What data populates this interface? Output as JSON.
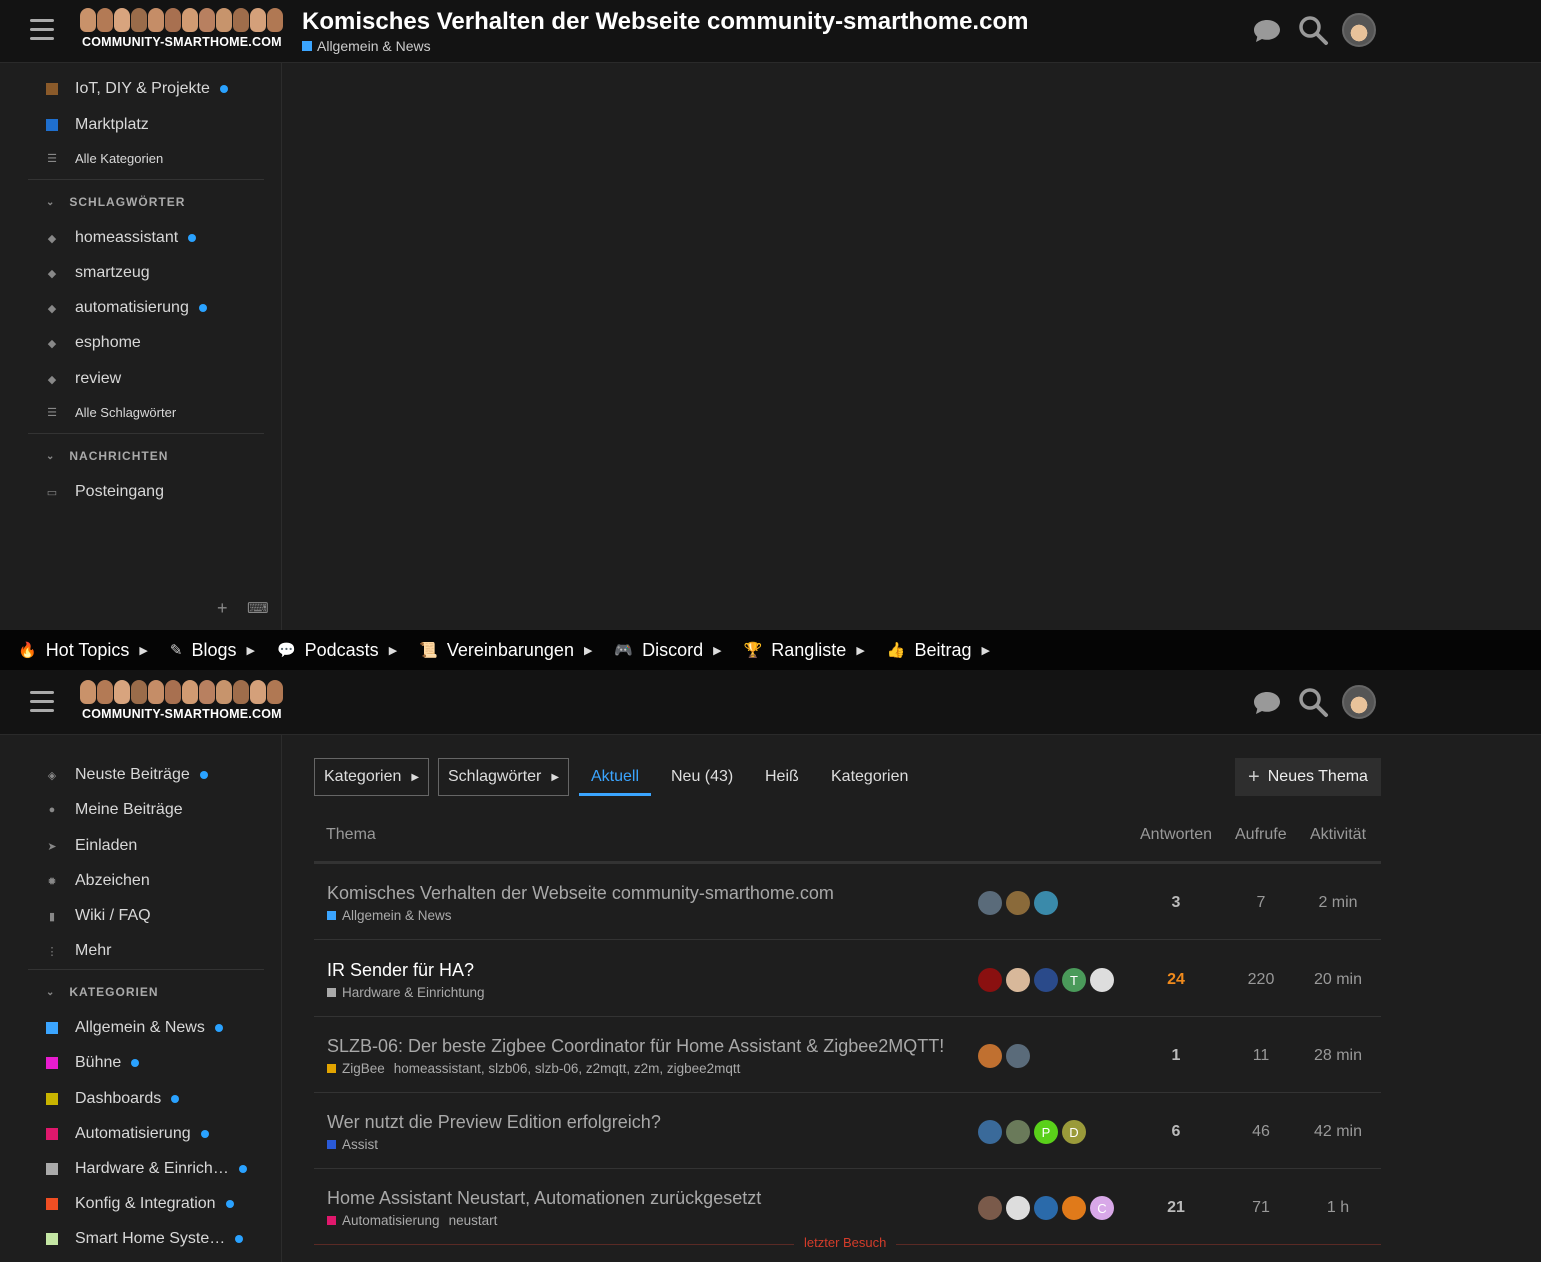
{
  "top_header": {
    "logo_text": "COMMUNITY-SMARTHOME.COM",
    "topic_title": "Komisches Verhalten der Webseite community-smarthome.com",
    "topic_category": "Allgemein & News",
    "category_color": "#3ba5ff"
  },
  "top_sidebar": {
    "categories": [
      {
        "label": "IoT, DIY & Projekte",
        "color": "#8a5a2a",
        "unread": true
      },
      {
        "label": "Marktplatz",
        "color": "#1f6fce",
        "unread": false
      }
    ],
    "all_categories": "Alle Kategorien",
    "tags_heading": "SCHLAGWÖRTER",
    "tags": [
      {
        "label": "homeassistant",
        "unread": true
      },
      {
        "label": "smartzeug",
        "unread": false
      },
      {
        "label": "automatisierung",
        "unread": true
      },
      {
        "label": "esphome",
        "unread": false
      },
      {
        "label": "review",
        "unread": false
      }
    ],
    "all_tags": "Alle Schlagwörter",
    "messages_heading": "NACHRICHTEN",
    "inbox": "Posteingang",
    "footer_plus": "+",
    "footer_keyboard": "⌨"
  },
  "navbar": [
    {
      "icon": "fire-icon",
      "label": "Hot Topics"
    },
    {
      "icon": "edit-icon",
      "label": "Blogs"
    },
    {
      "icon": "comments-icon",
      "label": "Podcasts"
    },
    {
      "icon": "scroll-icon",
      "label": "Vereinbarungen"
    },
    {
      "icon": "discord-icon",
      "label": "Discord"
    },
    {
      "icon": "trophy-icon",
      "label": "Rangliste"
    },
    {
      "icon": "thumbs-up-icon",
      "label": "Beitrag"
    }
  ],
  "bottom_header": {
    "logo_text": "COMMUNITY-SMARTHOME.COM"
  },
  "bottom_sidebar": {
    "items": [
      {
        "icon": "layers-icon",
        "label": "Neuste Beiträge",
        "unread": true
      },
      {
        "icon": "user-icon",
        "label": "Meine Beiträge",
        "unread": false
      },
      {
        "icon": "paper-plane-icon",
        "label": "Einladen",
        "unread": false
      },
      {
        "icon": "certificate-icon",
        "label": "Abzeichen",
        "unread": false
      },
      {
        "icon": "book-icon",
        "label": "Wiki / FAQ",
        "unread": false
      },
      {
        "icon": "ellipsis-icon",
        "label": "Mehr",
        "unread": false
      }
    ],
    "categories_heading": "KATEGORIEN",
    "categories": [
      {
        "label": "Allgemein & News",
        "color": "#3ba5ff",
        "unread": true
      },
      {
        "label": "Bühne",
        "color": "#e81ccf",
        "unread": true
      },
      {
        "label": "Dashboards",
        "color": "#c8b400",
        "unread": true
      },
      {
        "label": "Automatisierung",
        "color": "#e0186c",
        "unread": true
      },
      {
        "label": "Hardware & Einrich…",
        "color": "#aaaaaa",
        "unread": true
      },
      {
        "label": "Konfig & Integration",
        "color": "#f04e23",
        "unread": true
      },
      {
        "label": "Smart Home Syste…",
        "color": "#c4e6a4",
        "unread": true
      }
    ]
  },
  "filters": {
    "categories_dropdown": "Kategorien",
    "tags_dropdown": "Schlagwörter",
    "tabs": [
      "Aktuell",
      "Neu (43)",
      "Heiß",
      "Kategorien"
    ],
    "active_tab": "Aktuell",
    "new_topic_button": "Neues Thema"
  },
  "table": {
    "headers": {
      "topic": "Thema",
      "replies": "Antworten",
      "views": "Aufrufe",
      "activity": "Aktivität"
    },
    "rows": [
      {
        "title": "Komisches Verhalten der Webseite community-smarthome.com",
        "category": "Allgemein & News",
        "category_color": "#3ba5ff",
        "tags": "",
        "unread": false,
        "posters": [
          {
            "initial": "",
            "color": "#5a6b7a"
          },
          {
            "initial": "",
            "color": "#8a6a3a"
          },
          {
            "initial": "",
            "color": "#3a8aaa"
          }
        ],
        "replies": "3",
        "replies_hot": false,
        "views": "7",
        "activity": "2 min"
      },
      {
        "title": "IR Sender für HA?",
        "category": "Hardware & Einrichtung",
        "category_color": "#aaaaaa",
        "tags": "",
        "unread": true,
        "posters": [
          {
            "initial": "",
            "color": "#8a1010"
          },
          {
            "initial": "",
            "color": "#d8b89a"
          },
          {
            "initial": "",
            "color": "#2a4a8a"
          },
          {
            "initial": "T",
            "color": "#4a9a5a"
          },
          {
            "initial": "",
            "color": "#ddd"
          }
        ],
        "replies": "24",
        "replies_hot": true,
        "views": "220",
        "activity": "20 min"
      },
      {
        "title": "SLZB-06: Der beste Zigbee Coordinator für Home Assistant & Zigbee2MQTT!",
        "category": "ZigBee",
        "category_color": "#e2a400",
        "tags": "homeassistant, slzb06, slzb-06, z2mqtt, z2m, zigbee2mqtt",
        "unread": false,
        "posters": [
          {
            "initial": "",
            "color": "#c07030"
          },
          {
            "initial": "",
            "color": "#5a6b7a"
          }
        ],
        "replies": "1",
        "replies_hot": false,
        "views": "11",
        "activity": "28 min"
      },
      {
        "title": "Wer nutzt die Preview Edition erfolgreich?",
        "category": "Assist",
        "category_color": "#2a5ad8",
        "tags": "",
        "unread": false,
        "posters": [
          {
            "initial": "",
            "color": "#3a6a9a"
          },
          {
            "initial": "",
            "color": "#6a7a5a"
          },
          {
            "initial": "P",
            "color": "#5ad01a"
          },
          {
            "initial": "D",
            "color": "#9a9a3a"
          }
        ],
        "replies": "6",
        "replies_hot": false,
        "views": "46",
        "activity": "42 min"
      },
      {
        "title": "Home Assistant Neustart, Automationen zurückgesetzt",
        "category": "Automatisierung",
        "category_color": "#e0186c",
        "tags": "neustart",
        "unread": false,
        "posters": [
          {
            "initial": "",
            "color": "#7a5a4a"
          },
          {
            "initial": "",
            "color": "#ddd"
          },
          {
            "initial": "",
            "color": "#2a6aaa"
          },
          {
            "initial": "",
            "color": "#e07a1a"
          },
          {
            "initial": "C",
            "color": "#d8a8e8"
          }
        ],
        "replies": "21",
        "replies_hot": false,
        "views": "71",
        "activity": "1 h"
      }
    ]
  },
  "last_visit_label": "letzter Besuch"
}
